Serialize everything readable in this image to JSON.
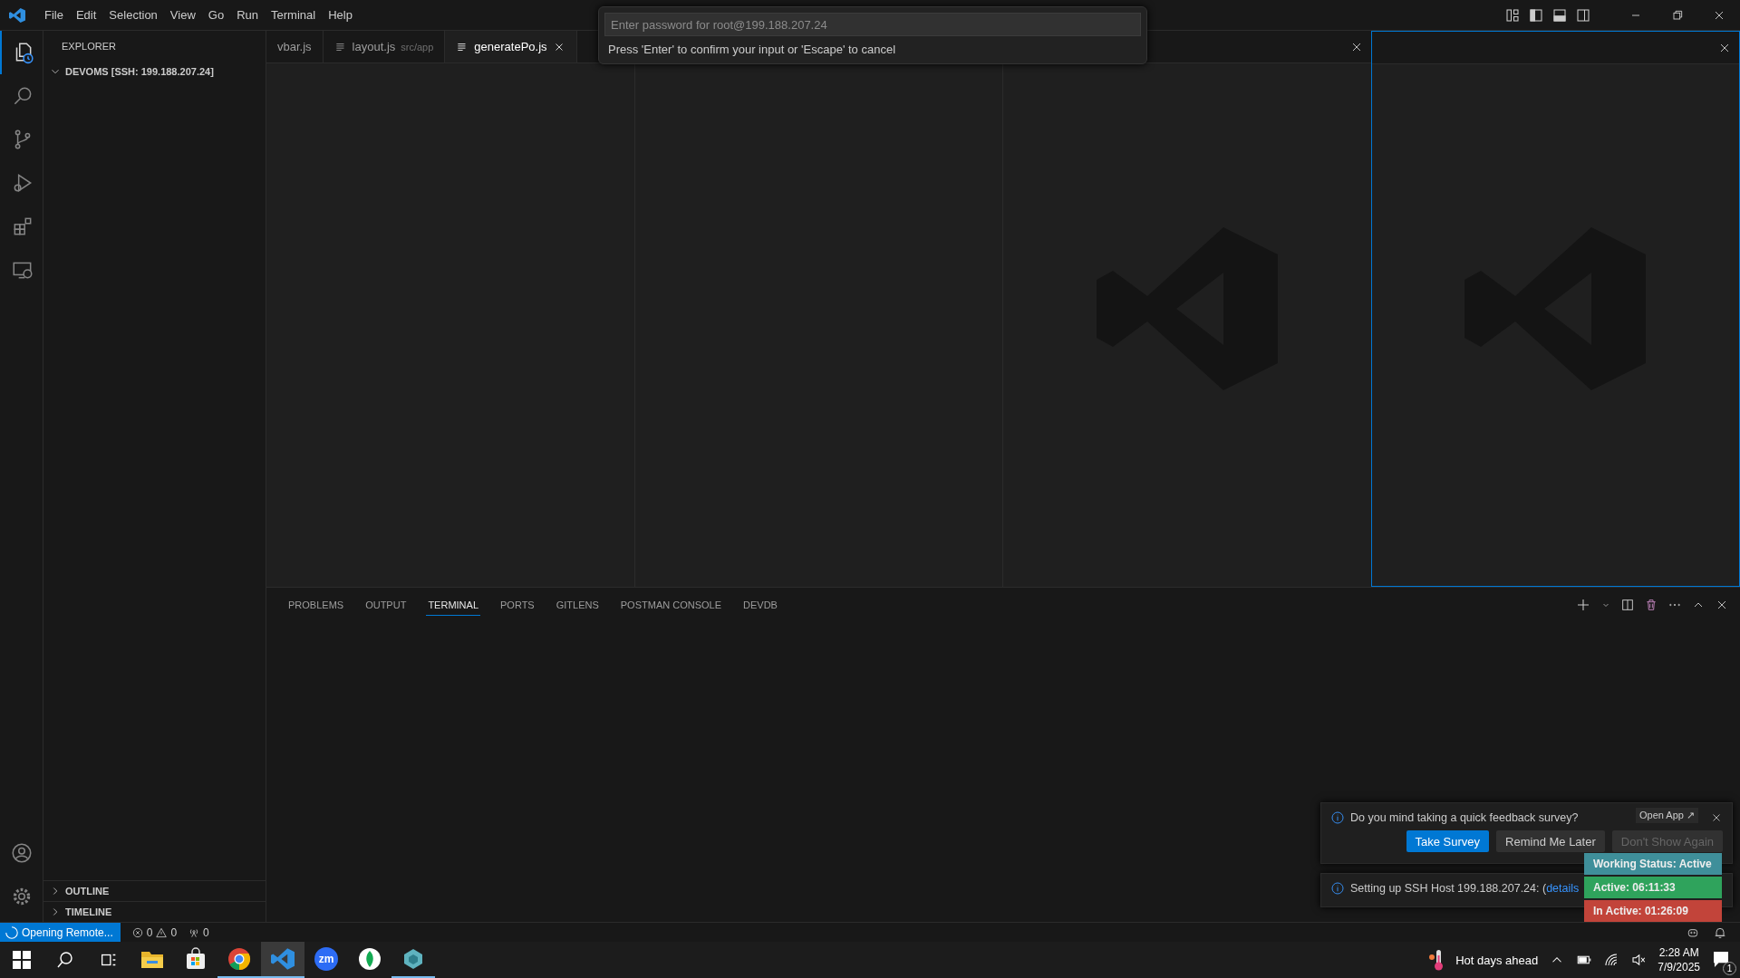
{
  "title_bar": {
    "menu": [
      "File",
      "Edit",
      "Selection",
      "View",
      "Go",
      "Run",
      "Terminal",
      "Help"
    ]
  },
  "activity_bar": {
    "items": [
      {
        "kind": "explorer",
        "selected": true
      },
      {
        "kind": "search",
        "selected": false
      },
      {
        "kind": "source_control",
        "selected": false
      },
      {
        "kind": "run",
        "selected": false
      },
      {
        "kind": "extensions",
        "selected": false
      },
      {
        "kind": "remote",
        "selected": false
      }
    ]
  },
  "sidebar": {
    "title": "EXPLORER",
    "folder": {
      "label": "DEVOMS [SSH: 199.188.207.24]",
      "expanded": true
    },
    "sections": [
      {
        "label": "OUTLINE",
        "expanded": false
      },
      {
        "label": "TIMELINE",
        "expanded": false
      }
    ]
  },
  "editor_tabs": [
    {
      "label": "vbar.js",
      "selected": false
    },
    {
      "label": "layout.js",
      "description": "src/app",
      "selected": false
    },
    {
      "label": "generatePo.js",
      "selected": true
    }
  ],
  "editor_groups": [
    {
      "focused": false,
      "closable": false,
      "watermark": false
    },
    {
      "focused": false,
      "closable": false,
      "watermark": false
    },
    {
      "focused": false,
      "closable": true,
      "watermark": true
    },
    {
      "focused": true,
      "closable": true,
      "watermark": true
    }
  ],
  "quick_input": {
    "placeholder": "Enter password for root@199.188.207.24",
    "message": "Press 'Enter' to confirm your input or 'Escape' to cancel"
  },
  "panel": {
    "tabs": [
      {
        "label": "PROBLEMS",
        "selected": false
      },
      {
        "label": "OUTPUT",
        "selected": false
      },
      {
        "label": "TERMINAL",
        "selected": true
      },
      {
        "label": "PORTS",
        "selected": false
      },
      {
        "label": "GITLENS",
        "selected": false
      },
      {
        "label": "POSTMAN CONSOLE",
        "selected": false
      },
      {
        "label": "DEVDB",
        "selected": false
      }
    ]
  },
  "notifications": [
    {
      "message": "Do you mind taking a quick feedback survey?",
      "buttons": [
        {
          "label": "Take Survey",
          "primary": true
        },
        {
          "label": "Remind Me Later",
          "primary": false
        },
        {
          "label": "Don't Show Again",
          "primary": false
        }
      ]
    },
    {
      "message": "Setting up SSH Host 199.188.207.24: (",
      "link": "details"
    }
  ],
  "open_app": "Open App ↗",
  "status_widget": [
    {
      "label": "Working Status: Active",
      "color": "#3f8f9a"
    },
    {
      "label": "Active: 06:11:33",
      "color": "#2fa35c"
    },
    {
      "label": "In Active: 01:26:09",
      "color": "#c2443a"
    }
  ],
  "status_bar": {
    "remote": "Opening Remote...",
    "errors": "0",
    "warnings": "0",
    "ports": "0"
  },
  "taskbar": {
    "apps": [
      {
        "kind": "files",
        "running": false,
        "active": false
      },
      {
        "kind": "store",
        "running": false,
        "active": false
      },
      {
        "kind": "chrome",
        "running": true,
        "active": false
      },
      {
        "kind": "vscode",
        "running": true,
        "active": true
      },
      {
        "kind": "zoom",
        "label": "zm",
        "running": false,
        "active": false
      },
      {
        "kind": "leaf",
        "running": false,
        "active": false
      },
      {
        "kind": "hexagon",
        "running": true,
        "active": false
      }
    ],
    "weather": "Hot days ahead",
    "time": "2:28 AM",
    "date": "7/9/2025",
    "notification_count": "1"
  }
}
